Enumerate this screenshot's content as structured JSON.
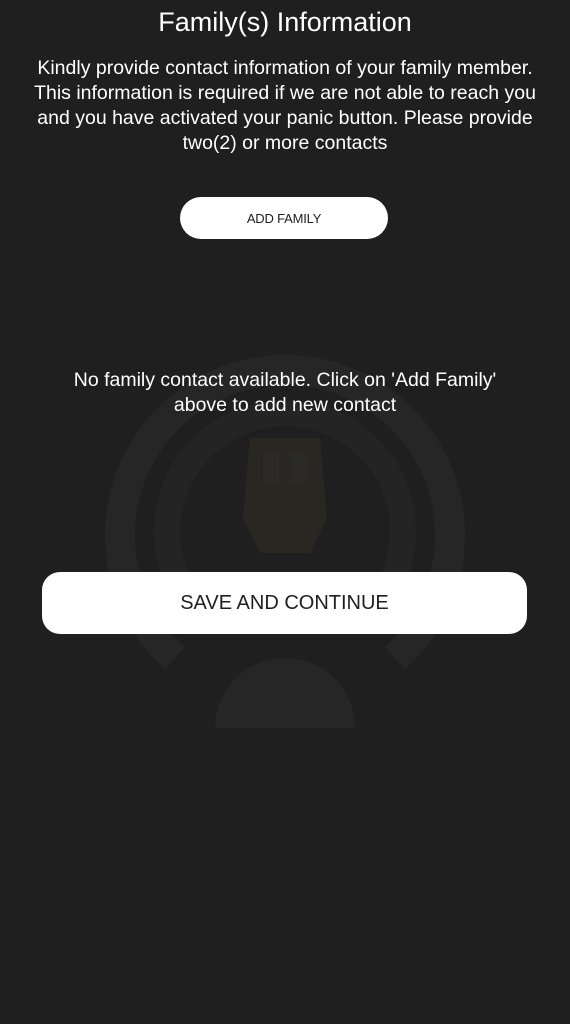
{
  "header": {
    "title": "Family(s) Information"
  },
  "main": {
    "description": "Kindly provide contact information of your family member. This information is required if we are not able to reach you and you have activated your panic button. Please provide two(2) or more contacts",
    "add_family_label": "ADD FAMILY",
    "empty_message": "No family contact available. Click on 'Add Family' above to add new contact",
    "save_label": "SAVE AND CONTINUE"
  },
  "icons": {
    "watermark": "panic-logo-icon"
  },
  "colors": {
    "background": "#1f1f1f",
    "text": "#ffffff",
    "button_background": "#ffffff",
    "button_text": "#1f1f1f"
  }
}
